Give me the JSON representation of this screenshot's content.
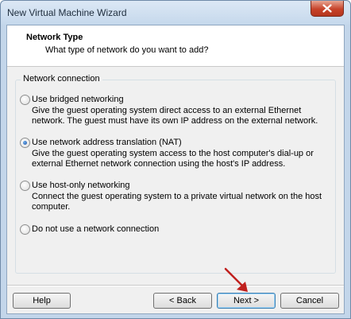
{
  "window": {
    "title": "New Virtual Machine Wizard"
  },
  "header": {
    "title": "Network Type",
    "subtitle": "What type of network do you want to add?"
  },
  "network_group": {
    "legend": "Network connection",
    "options": [
      {
        "label": "Use bridged networking",
        "description": "Give the guest operating system direct access to an external Ethernet network. The guest must have its own IP address on the external network.",
        "checked": false
      },
      {
        "label": "Use network address translation (NAT)",
        "description": "Give the guest operating system access to the host computer's dial-up or external Ethernet network connection using the host's IP address.",
        "checked": true
      },
      {
        "label": "Use host-only networking",
        "description": "Connect the guest operating system to a private virtual network on the host computer.",
        "checked": false
      },
      {
        "label": "Do not use a network connection",
        "description": "",
        "checked": false
      }
    ]
  },
  "buttons": {
    "help": "Help",
    "back": "< Back",
    "next": "Next >",
    "cancel": "Cancel"
  },
  "icons": {
    "close": "close-icon",
    "annotation": "red-arrow-icon"
  },
  "colors": {
    "accent_arrow": "#c0201e",
    "close_button": "#c7432a"
  }
}
